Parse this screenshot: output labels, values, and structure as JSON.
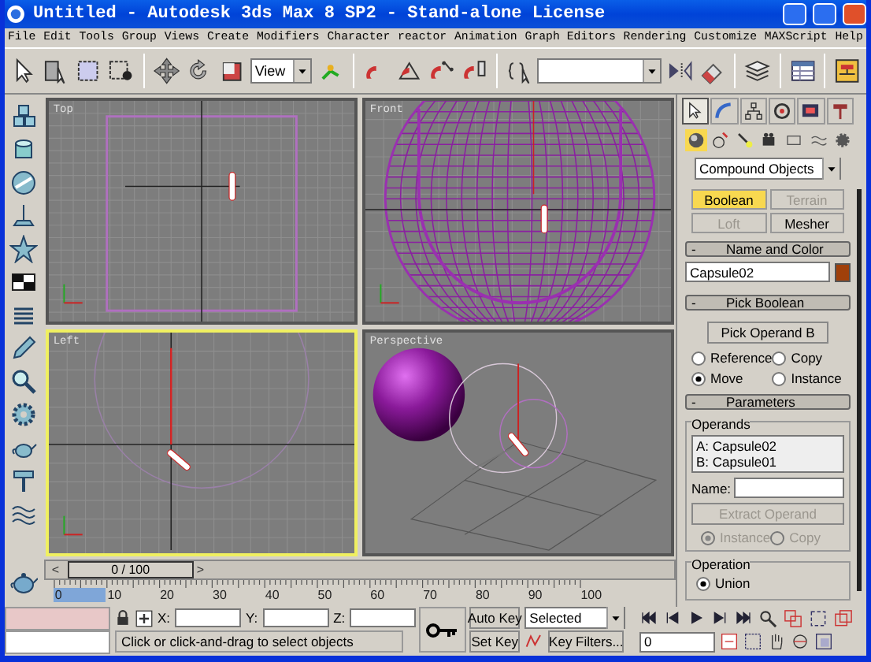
{
  "window": {
    "title": "Untitled - Autodesk 3ds Max 8 SP2  - Stand-alone License"
  },
  "menu": [
    "File",
    "Edit",
    "Tools",
    "Group",
    "Views",
    "Create",
    "Modifiers",
    "Character",
    "reactor",
    "Animation",
    "Graph Editors",
    "Rendering",
    "Customize",
    "MAXScript",
    "Help"
  ],
  "toolbar": {
    "reference_coordinate": "View"
  },
  "viewports": [
    {
      "label": "Top",
      "kind": "top",
      "active": false
    },
    {
      "label": "Front",
      "kind": "front",
      "active": false
    },
    {
      "label": "Left",
      "kind": "left",
      "active": true
    },
    {
      "label": "Perspective",
      "kind": "perspective",
      "active": false
    }
  ],
  "time_slider": {
    "level": 0,
    "prev": "<",
    "position": "0 / 100",
    "next": ">"
  },
  "track_bar": {
    "labels": [
      "0",
      "10",
      "20",
      "30",
      "40",
      "50",
      "60",
      "70",
      "80",
      "90",
      "100"
    ]
  },
  "command_panel": {
    "tabs": [
      {
        "selected": true
      },
      {
        "selected": false
      },
      {
        "selected": false
      },
      {
        "selected": false
      },
      {
        "selected": false
      },
      {
        "selected": false
      }
    ],
    "categories": [
      {
        "selected": true
      },
      {
        "selected": false
      },
      {
        "selected": false
      },
      {
        "selected": false
      },
      {
        "selected": false
      },
      {
        "selected": false
      },
      {
        "selected": false
      }
    ],
    "dropdown": "Compound Objects",
    "object_types": [
      {
        "label": "Boolean",
        "selected": true,
        "disabled": false
      },
      {
        "label": "Terrain",
        "selected": false,
        "disabled": true
      },
      {
        "label": "Loft",
        "selected": false,
        "disabled": true
      },
      {
        "label": "Mesher",
        "selected": false,
        "disabled": false
      }
    ],
    "name_color": {
      "toggle": "-",
      "title": "Name and Color",
      "name": "Capsule02",
      "color": "#a0400a"
    },
    "pick_boolean": {
      "toggle": "-",
      "title": "Pick Boolean",
      "button": "Pick Operand B",
      "options": [
        {
          "label": "Reference",
          "selected": false
        },
        {
          "label": "Copy",
          "selected": false
        },
        {
          "label": "Move",
          "selected": true
        },
        {
          "label": "Instance",
          "selected": false
        }
      ]
    },
    "parameters": {
      "toggle": "-",
      "title": "Parameters",
      "operands_label": "Operands",
      "operands": [
        "A: Capsule02",
        "B: Capsule01"
      ],
      "name_label": "Name:",
      "extract_button": "Extract Operand",
      "extract_disabled": true,
      "extract_options": [
        {
          "label": "Instance",
          "selected": true
        },
        {
          "label": "Copy",
          "selected": false
        }
      ],
      "operation_label": "Operation",
      "operations": [
        {
          "label": "Union",
          "selected": true
        }
      ]
    }
  },
  "status": {
    "prompt": "Click or click-and-drag to select objects",
    "x_label": "X:",
    "y_label": "Y:",
    "z_label": "Z:",
    "auto_key": "Auto Key",
    "set_key": "Set Key",
    "key_mode": "Selected",
    "key_filters": "Key Filters...",
    "current_frame": "0"
  }
}
